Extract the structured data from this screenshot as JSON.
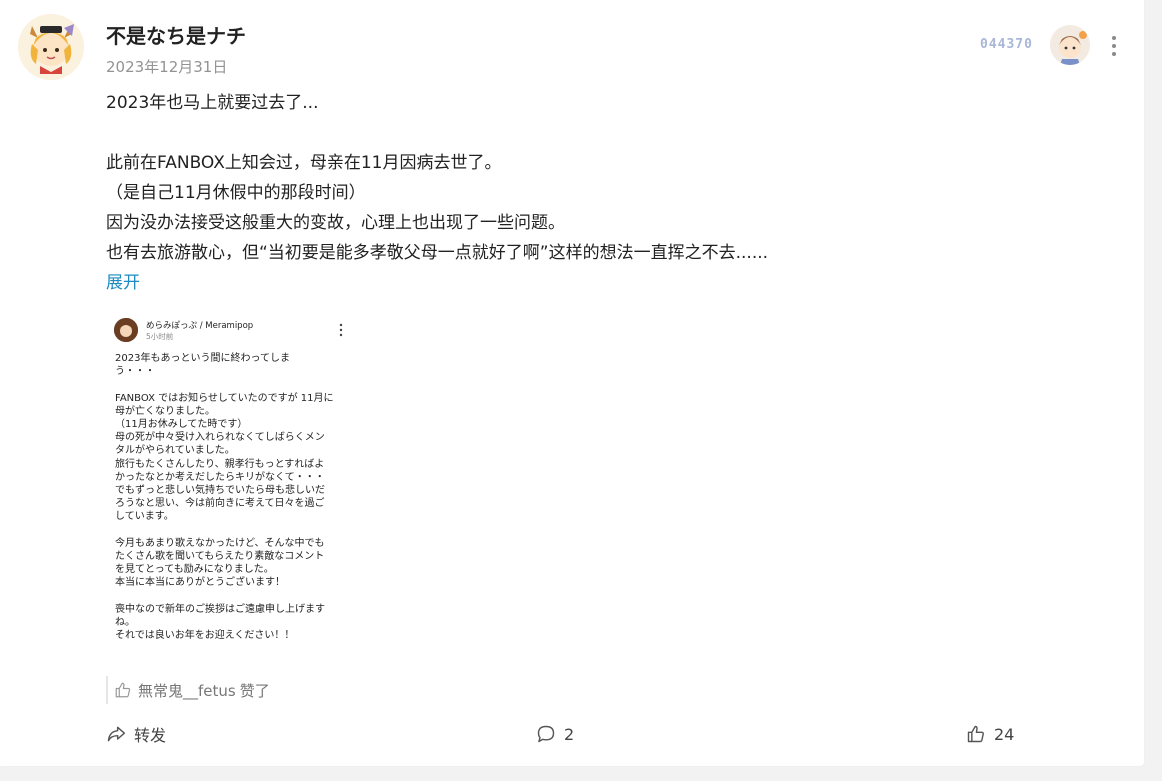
{
  "post": {
    "username": "不是なち是ナチ",
    "date": "2023年12月31日",
    "badge_number": "044370",
    "content_lines": [
      "2023年也马上就要过去了...",
      "",
      "此前在FANBOX上知会过，母亲在11月因病去世了。",
      "（是自己11月休假中的那段时间）",
      "因为没办法接受这般重大的变故，心理上也出现了一些问题。",
      "也有去旅游散心，但“当初要是能多孝敬父母一点就好了啊”这样的想法一直挥之不去......"
    ],
    "expand_label": "展开"
  },
  "embed": {
    "name": "めらみぽっぷ / Meramipop",
    "time": "5小时前",
    "lines": [
      "2023年もあっという間に終わってしま",
      "う・・・",
      "",
      "FANBOX ではお知らせしていたのですが 11月に",
      "母が亡くなりました。",
      "（11月お休みしてた時です）",
      "母の死が中々受け入れられなくてしばらくメン",
      "タルがやられていました。",
      "旅行もたくさんしたり、親孝行もっとすればよ",
      "かったなとか考えだしたらキリがなくて・・・",
      "でもずっと悲しい気持ちでいたら母も悲しいだ",
      "ろうなと思い、今は前向きに考えて日々を過ご",
      "しています。",
      "",
      "今月もあまり歌えなかったけど、そんな中でも",
      "たくさん歌を聞いてもらえたり素敵なコメント",
      "を見てとっても励みになりました。",
      "本当に本当にありがとうございます！",
      "",
      "喪中なので新年のご挨拶はご遠慮申し上げます",
      "ね。",
      "それでは良いお年をお迎えください！！"
    ]
  },
  "likes": {
    "liker": "無常鬼__fetus",
    "suffix": "赞了"
  },
  "actions": {
    "repost_label": "转发",
    "comment_count": "2",
    "like_count": "24"
  }
}
